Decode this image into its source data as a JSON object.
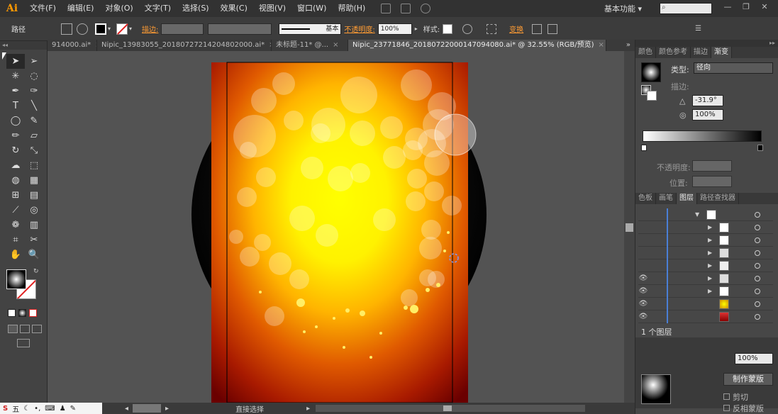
{
  "app": {
    "logo": "Ai",
    "workspace": "基本功能 ▾",
    "search_placeholder": ""
  },
  "menu": [
    "文件(F)",
    "编辑(E)",
    "对象(O)",
    "文字(T)",
    "选择(S)",
    "效果(C)",
    "视图(V)",
    "窗口(W)",
    "帮助(H)"
  ],
  "control": {
    "path_label": "路径",
    "stroke_label": "描边:",
    "stroke_style": "基本",
    "opacity_label": "不透明度:",
    "opacity_value": "100%",
    "style_label": "样式:",
    "transform_label": "变换"
  },
  "tabs": [
    {
      "label": "914000.ai*",
      "close": "×"
    },
    {
      "label": "Nipic_13983055_20180727214204802000.ai*",
      "close": "×"
    },
    {
      "label": "未标题-11* @...",
      "close": "×"
    },
    {
      "label": "Nipic_23771846_20180722000147094080.ai* @ 32.55% (RGB/预览)",
      "close": "×"
    }
  ],
  "panel": {
    "top_tabs": [
      "颜色",
      "颜色参考",
      "描边",
      "渐变"
    ],
    "gradient_type_label": "类型:",
    "gradient_type_value": "径向",
    "stroke_label": "描边:",
    "angle_value": "-31.9°",
    "aspect_value": "100%",
    "opacity_label": "不透明度:",
    "position_label": "位置:",
    "layer_tabs": [
      "色板",
      "画笔",
      "图层",
      "路径查找器"
    ],
    "layer_count": "1 个图层",
    "transparency_opacity": "100%",
    "make_mask": "制作蒙版",
    "clip": "剪切",
    "invert_mask": "反相蒙版"
  },
  "status": {
    "tool": "直接选择",
    "ime": "五"
  },
  "colors": {
    "accent": "#ff9c34",
    "layer_blue": "#4a7fd6"
  }
}
